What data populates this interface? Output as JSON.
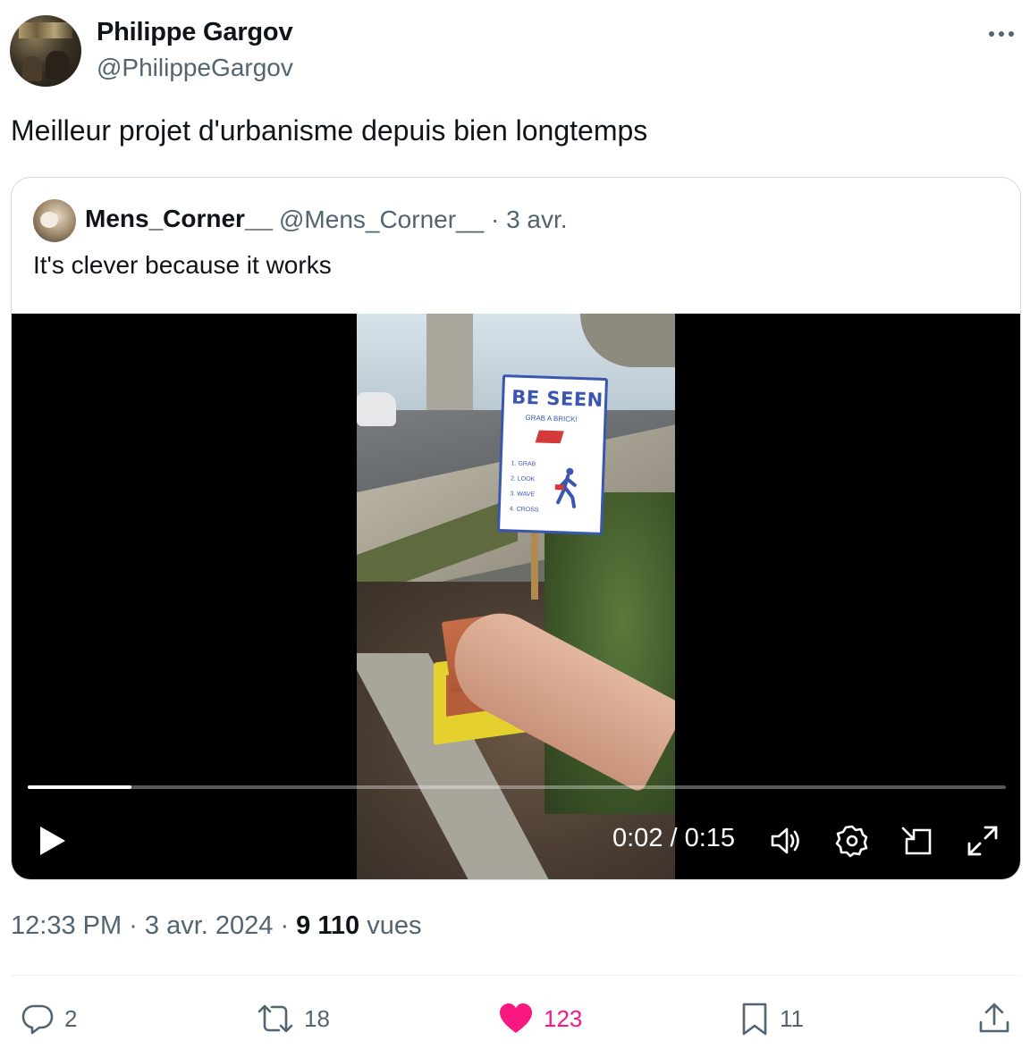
{
  "author": {
    "name": "Philippe Gargov",
    "handle": "@PhilippeGargov"
  },
  "tweet": {
    "text": "Meilleur projet d'urbanisme depuis bien longtemps"
  },
  "quote": {
    "name": "Mens_Corner__",
    "handle_date": "@Mens_Corner__ · 3 avr.",
    "text": "It's clever because it works"
  },
  "video": {
    "time": "0:02 / 0:15",
    "progress": 0.106,
    "sign": {
      "title": "BE SEEN",
      "subtitle": "GRAB A BRICK!",
      "steps": [
        "1. GRAB",
        "2. LOOK",
        "3. WAVE",
        "4. CROSS"
      ]
    }
  },
  "meta": {
    "time_date": "12:33 PM · 3 avr. 2024 · ",
    "views_count": "9 110",
    "views_label": " vues"
  },
  "actions": {
    "replies": "2",
    "reposts": "18",
    "likes": "123",
    "bookmarks": "11"
  },
  "colors": {
    "like": "#f91880",
    "secondary_text": "#536471",
    "primary_text": "#0f1419"
  },
  "icons": [
    "more-icon",
    "play-icon",
    "volume-icon",
    "settings-icon",
    "pip-icon",
    "fullscreen-icon",
    "reply-icon",
    "repost-icon",
    "like-icon",
    "bookmark-icon",
    "share-icon"
  ]
}
